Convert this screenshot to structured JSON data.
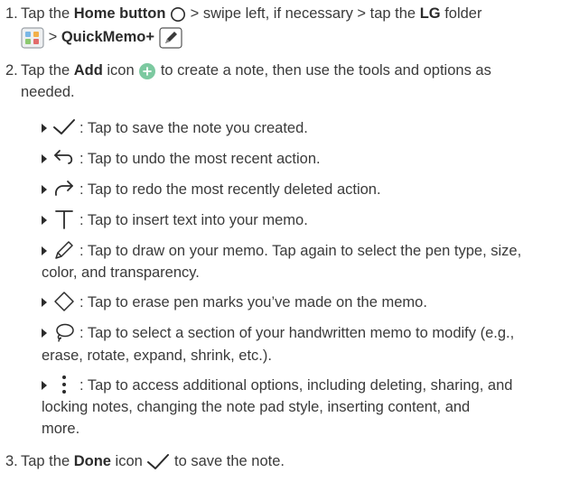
{
  "steps": [
    {
      "number": "1.",
      "t_tap1": "Tap the ",
      "home_label": "Home button",
      "t_swipe": " > swipe left, if necessary > tap the ",
      "lg_label": "LG",
      "t_folder": " folder",
      "t_gt": " > ",
      "quickmemo_label": "QuickMemo+"
    },
    {
      "number": "2.",
      "t_tap": "Tap the ",
      "add_label": "Add",
      "t_icon": " icon ",
      "t_rest1": " to create a note, then use the tools and options as",
      "t_rest2": "needed."
    },
    {
      "number": "3.",
      "t_tap": "Tap the ",
      "done_label": "Done",
      "t_icon": " icon ",
      "t_rest": " to save the note."
    }
  ],
  "tools": [
    {
      "icon": "checkmark-icon",
      "lines": [
        ": Tap to save the note you created."
      ]
    },
    {
      "icon": "undo-icon",
      "lines": [
        ": Tap to undo the most recent action."
      ]
    },
    {
      "icon": "redo-icon",
      "lines": [
        ": Tap to redo the most recently deleted action."
      ]
    },
    {
      "icon": "text-icon",
      "lines": [
        ": Tap to insert text into your memo."
      ]
    },
    {
      "icon": "pen-icon",
      "lines": [
        ": Tap to draw on your memo. Tap again to select the pen type, size,",
        "color, and transparency."
      ]
    },
    {
      "icon": "eraser-icon",
      "lines": [
        ": Tap to erase pen marks you’ve made on the memo."
      ]
    },
    {
      "icon": "lasso-icon",
      "lines": [
        ": Tap to select a section of your handwritten memo to modify (e.g.,",
        "erase, rotate, expand, shrink, etc.)."
      ]
    },
    {
      "icon": "more-options-icon",
      "lines": [
        ": Tap to access additional options, including deleting, sharing, and",
        "locking notes, changing the note pad style, inserting content, and",
        "more."
      ]
    }
  ],
  "colors": {
    "add_icon": "#7cc9a0",
    "text": "#3a3a3a"
  }
}
